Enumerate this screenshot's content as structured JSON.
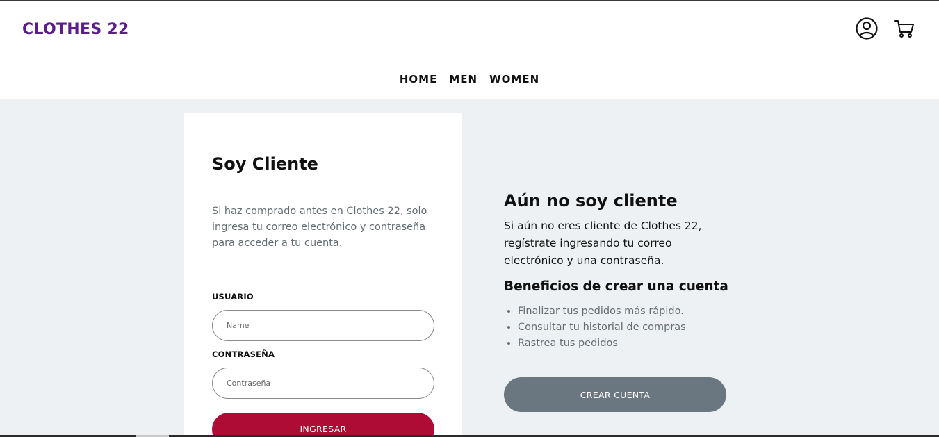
{
  "header": {
    "brand": "CLOTHES 22",
    "brand_color": "#5a1e8c",
    "icons": [
      "user-circle-icon",
      "shopping-cart-icon"
    ]
  },
  "nav": {
    "items": [
      {
        "label": "HOME"
      },
      {
        "label": "MEN"
      },
      {
        "label": "WOMEN"
      }
    ]
  },
  "login": {
    "title": "Soy Cliente",
    "description": "Si haz comprado antes en Clothes 22, solo ingresa tu correo electrónico y contraseña para acceder a tu cuenta.",
    "user_label": "USUARIO",
    "user_placeholder": "Name",
    "password_label": "CONTRASEÑA",
    "password_placeholder": "Contraseña",
    "submit_label": "INGRESAR",
    "submit_color": "#ae0c35"
  },
  "register": {
    "title": "Aún no soy cliente",
    "description": "Si aún no eres cliente de Clothes 22, regístrate ingresando tu correo electrónico y una contraseña.",
    "benefits_title": "Beneficios de crear una cuenta",
    "benefits": [
      "Finalizar tus pedidos más rápido.",
      "Consultar tu historial de compras",
      "Rastrea tus pedidos"
    ],
    "button_label": "CREAR CUENTA",
    "button_color": "#6a7780"
  }
}
